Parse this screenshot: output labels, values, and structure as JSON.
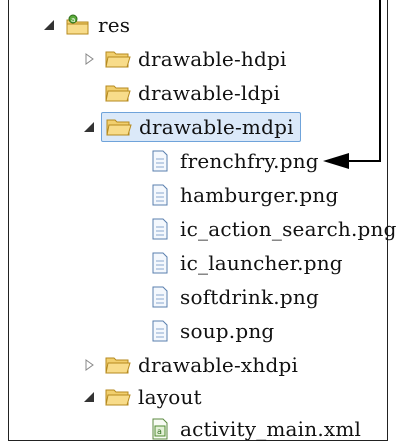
{
  "tree": {
    "root": {
      "label": "res",
      "icon": "resource-folder-icon"
    },
    "items": [
      {
        "label": "drawable-hdpi",
        "icon": "folder-icon",
        "state": "collapsed"
      },
      {
        "label": "drawable-ldpi",
        "icon": "folder-icon",
        "state": "leaf"
      },
      {
        "label": "drawable-mdpi",
        "icon": "folder-icon",
        "state": "expanded",
        "selected": true
      },
      {
        "label": "frenchfry.png",
        "icon": "image-file-icon"
      },
      {
        "label": "hamburger.png",
        "icon": "image-file-icon"
      },
      {
        "label": "ic_action_search.png",
        "icon": "image-file-icon"
      },
      {
        "label": "ic_launcher.png",
        "icon": "image-file-icon"
      },
      {
        "label": "softdrink.png",
        "icon": "image-file-icon"
      },
      {
        "label": "soup.png",
        "icon": "image-file-icon"
      },
      {
        "label": "drawable-xhdpi",
        "icon": "folder-icon",
        "state": "collapsed"
      },
      {
        "label": "layout",
        "icon": "folder-icon",
        "state": "expanded"
      },
      {
        "label": "activity_main.xml",
        "icon": "xml-file-icon"
      }
    ]
  },
  "colors": {
    "selection_bg": "#dbe9f9",
    "selection_border": "#6fa3da",
    "folder": "#e8b84a",
    "arrow": "#000000"
  }
}
